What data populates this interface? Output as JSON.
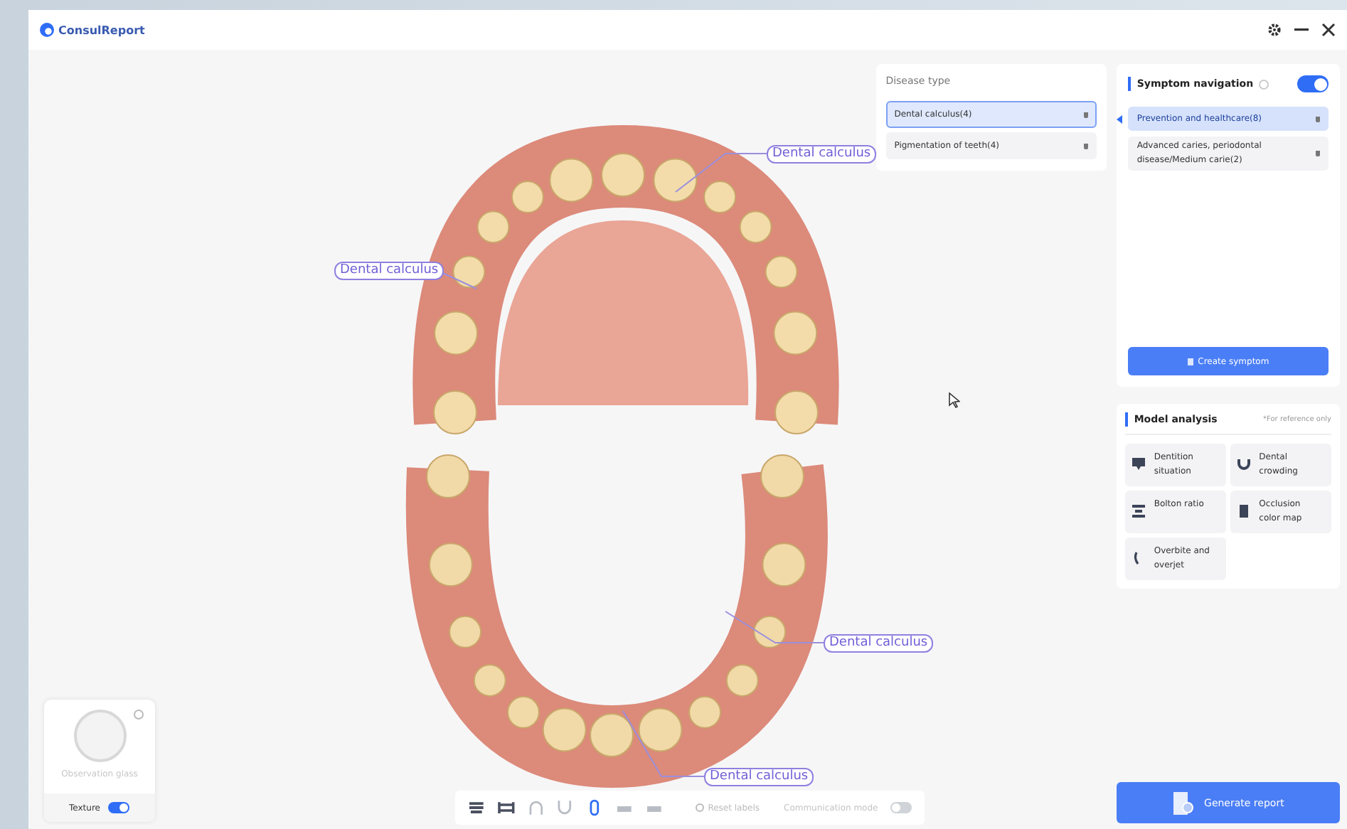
{
  "window": {
    "title": "ConsulReport"
  },
  "model": {
    "labels": [
      "Dental calculus",
      "Dental calculus",
      "Dental calculus",
      "Dental calculus"
    ]
  },
  "observation_glass": {
    "label": "Observation glass",
    "texture_label": "Texture",
    "texture_on": true
  },
  "toolbar": {
    "tools": [
      {
        "selected": false
      },
      {
        "selected": false
      },
      {
        "selected": false
      },
      {
        "selected": false
      },
      {
        "selected": true
      },
      {
        "selected": false
      },
      {
        "selected": false
      }
    ],
    "reset_label": "Reset labels",
    "communication_label": "Communication mode",
    "communication_on": false
  },
  "disease_type": {
    "title": "Disease type",
    "items": [
      {
        "label": "Dental calculus(4)",
        "selected": true
      },
      {
        "label": "Pigmentation of teeth(4)",
        "selected": false
      }
    ]
  },
  "symptom_navigation": {
    "title": "Symptom navigation",
    "on": true,
    "items": [
      {
        "label": "Prevention and healthcare(8)",
        "selected": true
      },
      {
        "label": "Advanced caries, periodontal disease/Medium carie(2)",
        "selected": false
      }
    ],
    "create_button": "Create symptom"
  },
  "model_analysis": {
    "title": "Model analysis",
    "note": "*For reference only",
    "items": [
      {
        "kind": "dentition",
        "label": "Dentition situation"
      },
      {
        "kind": "crowding",
        "label": "Dental crowding"
      },
      {
        "kind": "bolton",
        "label": "Bolton ratio"
      },
      {
        "kind": "occlusion",
        "label": "Occlusion color map"
      },
      {
        "kind": "overbite",
        "label": "Overbite and overjet"
      }
    ]
  },
  "generate_button": "Generate report"
}
